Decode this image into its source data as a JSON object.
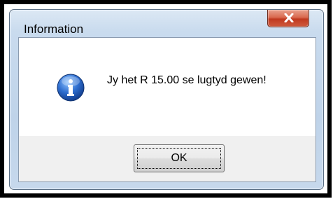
{
  "dialog": {
    "title": "Information",
    "message": "Jy het R 15.00 se lugtyd gewen!",
    "ok_label": "OK",
    "icon": "information-icon",
    "close_icon": "close-icon"
  },
  "colors": {
    "close_button": "#c0391f",
    "info_icon_blue": "#1f5fbf",
    "frame_border": "#000000"
  }
}
